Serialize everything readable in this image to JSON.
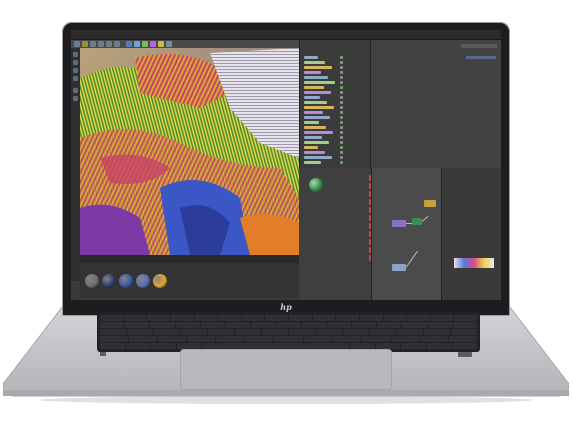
{
  "device": {
    "brand_logo": "hp",
    "body_color": "#c4c6c9",
    "bezel_color": "#1d1d1f"
  },
  "app": {
    "viewport_colors": [
      "#4e8d2a",
      "#d7a935",
      "#c84466",
      "#3b56c5",
      "#e0d44c",
      "#7d3aa4"
    ],
    "material_swatches": [
      "#6d6f73",
      "#2b3b6e",
      "#3b58a9",
      "#596fb5",
      "#e3a82a"
    ],
    "node_colors": [
      "#8a72c7",
      "#3c8c57",
      "#c7a03e",
      "#8aa3c9"
    ],
    "accent_red": "#c64646",
    "node_preview_color": "#2f7d41"
  }
}
